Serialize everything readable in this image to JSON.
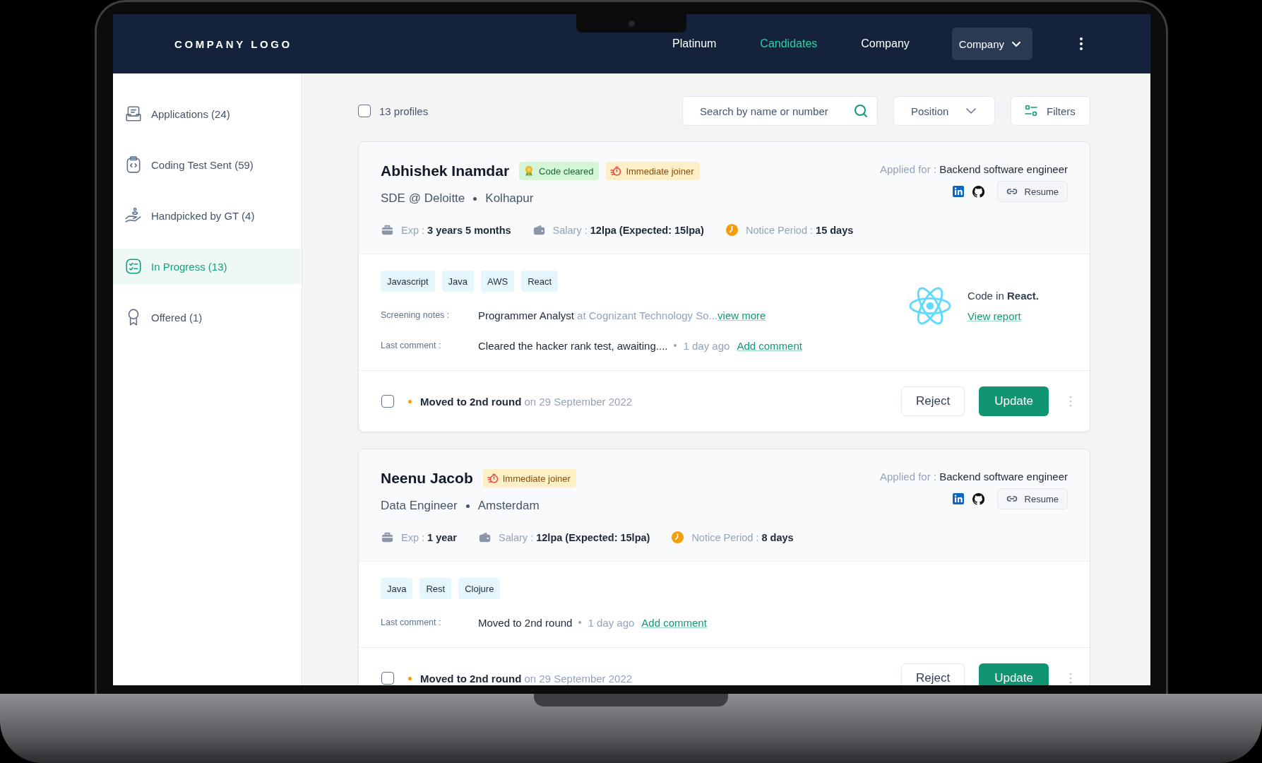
{
  "header": {
    "logo": "COMPANY LOGO",
    "nav": [
      {
        "label": "Platinum",
        "selected": false
      },
      {
        "label": "Candidates",
        "selected": true
      },
      {
        "label": "Company",
        "selected": false
      }
    ],
    "dropdown": "Company"
  },
  "sidebar": {
    "items": [
      {
        "label": "Applications (24)",
        "kind": "inbox",
        "selected": false
      },
      {
        "label": "Coding Test Sent (59)",
        "kind": "code",
        "selected": false
      },
      {
        "label": "Handpicked by GT (4)",
        "kind": "hand",
        "selected": false
      },
      {
        "label": "In Progress (13)",
        "kind": "checklist",
        "selected": true
      },
      {
        "label": "Offered (1)",
        "kind": "award",
        "selected": false
      }
    ]
  },
  "toolbar": {
    "select_all": {
      "checked": false
    },
    "count": "13 profiles",
    "search": {
      "placeholder": "Search by name or number"
    },
    "position": "Position",
    "filters": "Filters"
  },
  "candidates": [
    {
      "name": "Abhishek Inamdar",
      "badges": [
        {
          "kind": "code",
          "label": "Code cleared"
        },
        {
          "kind": "joiner",
          "label": "Immediate joiner"
        }
      ],
      "role": "SDE @ Deloitte",
      "location": "Kolhapur",
      "applied_label": "Applied for :",
      "applied": "Backend software engineer",
      "resume": "Resume",
      "exp_label": "Exp :",
      "exp": "3 years 5 months",
      "salary_label": "Salary :",
      "salary": "12lpa (Expected: 15lpa)",
      "notice_label": "Notice Period :",
      "notice": "15 days",
      "skills": [
        "Javascript",
        "Java",
        "AWS",
        "React"
      ],
      "notes": [
        {
          "kind": "screening",
          "label": "Screening notes :",
          "title": "Programmer Analyst",
          "detail": "at Cognizant Technology So...",
          "link": "view more"
        },
        {
          "kind": "comment",
          "label": "Last comment :",
          "text": "Cleared the hacker rank test, awaiting....",
          "time": "1 day ago",
          "link": "Add comment"
        }
      ],
      "code": {
        "text": "Code in **React.**",
        "link": "View report"
      },
      "checked": false,
      "status": "Moved to 2nd round",
      "date": "on 29 September 2022",
      "reject": "Reject",
      "update": "Update"
    },
    {
      "name": "Neenu Jacob",
      "badges": [
        {
          "kind": "joiner",
          "label": "Immediate joiner"
        }
      ],
      "role": "Data Engineer",
      "location": "Amsterdam",
      "applied_label": "Applied for :",
      "applied": "Backend software engineer",
      "resume": "Resume",
      "exp_label": "Exp :",
      "exp": "1 year",
      "salary_label": "Salary :",
      "salary": "12lpa (Expected: 15lpa)",
      "notice_label": "Notice Period :",
      "notice": "8 days",
      "skills": [
        "Java",
        "Rest",
        "Clojure"
      ],
      "notes": [
        {
          "kind": "comment",
          "label": "Last comment :",
          "text": "Moved to 2nd round",
          "time": "1 day ago",
          "link": "Add comment"
        }
      ],
      "checked": false,
      "status": "Moved to 2nd round",
      "date": "on 29 September 2022",
      "reject": "Reject",
      "update": "Update"
    }
  ]
}
